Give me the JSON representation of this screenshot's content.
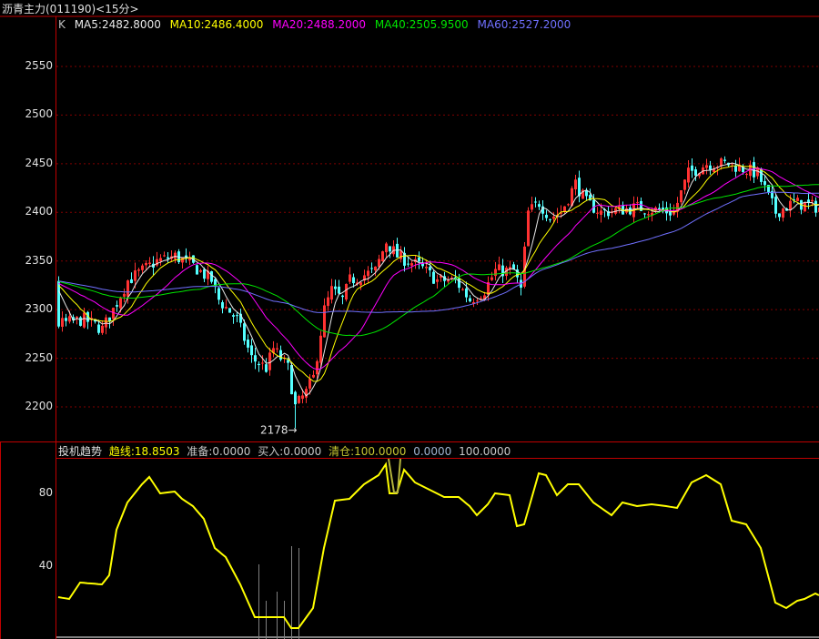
{
  "header": {
    "title": "沥青主力(011190)<15分>"
  },
  "legend": {
    "k": "K",
    "ma5": "MA5:2482.8000",
    "ma10": "MA10:2486.4000",
    "ma20": "MA20:2488.2000",
    "ma40": "MA40:2505.9500",
    "ma60": "MA60:2527.2000"
  },
  "indicator": {
    "name": "投机趋势",
    "trend": "趋线:18.8503",
    "prepare": "准备:0.0000",
    "buy": "买入:0.0000",
    "clear": "清仓:100.0000",
    "v1": "0.0000",
    "v2": "100.0000"
  },
  "colors": {
    "up": "#ff3232",
    "down": "#54ffff",
    "ma5": "#e8e8e8",
    "ma10": "#ffff00",
    "ma20": "#ff00ff",
    "ma40": "#00e600",
    "ma60": "#7070ff",
    "osc": "#ffff00",
    "axis": "#c00000",
    "grid": "#800000"
  },
  "chart_data": [
    {
      "type": "candlestick",
      "title": "沥青主力(011190)<15分>",
      "candle_count": 210,
      "ylim": [
        2170,
        2590
      ],
      "yticks": [
        "2550",
        "2500",
        "2450",
        "2400",
        "2350",
        "2300",
        "2250",
        "2200"
      ],
      "ytick_values": [
        2550,
        2500,
        2450,
        2400,
        2350,
        2300,
        2250,
        2200
      ],
      "close_keypoints": [
        [
          0,
          2285
        ],
        [
          7,
          2290
        ],
        [
          12,
          2280
        ],
        [
          15,
          2300
        ],
        [
          19,
          2330
        ],
        [
          27,
          2350
        ],
        [
          32,
          2355
        ],
        [
          37,
          2345
        ],
        [
          42,
          2330
        ],
        [
          44,
          2310
        ],
        [
          49,
          2290
        ],
        [
          53,
          2250
        ],
        [
          57,
          2240
        ],
        [
          59,
          2260
        ],
        [
          63,
          2240
        ],
        [
          65,
          2200
        ],
        [
          68,
          2215
        ],
        [
          70,
          2230
        ],
        [
          73,
          2300
        ],
        [
          75,
          2320
        ],
        [
          78,
          2310
        ],
        [
          80,
          2330
        ],
        [
          87,
          2340
        ],
        [
          90,
          2370
        ],
        [
          93,
          2355
        ],
        [
          99,
          2345
        ],
        [
          104,
          2330
        ],
        [
          109,
          2330
        ],
        [
          113,
          2310
        ],
        [
          117,
          2320
        ],
        [
          120,
          2340
        ],
        [
          125,
          2340
        ],
        [
          127,
          2320
        ],
        [
          129,
          2400
        ],
        [
          132,
          2410
        ],
        [
          135,
          2395
        ],
        [
          138,
          2400
        ],
        [
          142,
          2430
        ],
        [
          145,
          2410
        ],
        [
          149,
          2400
        ],
        [
          159,
          2405
        ],
        [
          169,
          2400
        ],
        [
          173,
          2440
        ],
        [
          178,
          2450
        ],
        [
          184,
          2450
        ],
        [
          192,
          2440
        ],
        [
          197,
          2400
        ],
        [
          202,
          2410
        ],
        [
          209,
          2405
        ]
      ],
      "prior_level": 2330,
      "low_marker": {
        "label": "2178",
        "index": 65,
        "value": 2178
      },
      "moving_averages": [
        5,
        10,
        20,
        40,
        60
      ]
    },
    {
      "type": "line",
      "title": "投机趋势",
      "ylim": [
        0,
        100
      ],
      "yticks": [
        "80",
        "40"
      ],
      "ytick_values": [
        80,
        40
      ],
      "series": [
        {
          "name": "趋线",
          "keypoints": [
            [
              0,
              23
            ],
            [
              3,
              22
            ],
            [
              6,
              31
            ],
            [
              12,
              30
            ],
            [
              14,
              35
            ],
            [
              16,
              60
            ],
            [
              19,
              75
            ],
            [
              23,
              85
            ],
            [
              25,
              89
            ],
            [
              28,
              80
            ],
            [
              32,
              81
            ],
            [
              34,
              77
            ],
            [
              37,
              73
            ],
            [
              40,
              66
            ],
            [
              43,
              50
            ],
            [
              46,
              45
            ],
            [
              50,
              30
            ],
            [
              54,
              12
            ],
            [
              58,
              12
            ],
            [
              62,
              12
            ],
            [
              64,
              6
            ],
            [
              66,
              6
            ],
            [
              70,
              17
            ],
            [
              73,
              50
            ],
            [
              76,
              76
            ],
            [
              80,
              77
            ],
            [
              84,
              85
            ],
            [
              88,
              90
            ],
            [
              90,
              96
            ],
            [
              91,
              80
            ],
            [
              93,
              80
            ],
            [
              95,
              93
            ],
            [
              98,
              86
            ],
            [
              102,
              82
            ],
            [
              106,
              78
            ],
            [
              110,
              78
            ],
            [
              113,
              73
            ],
            [
              115,
              68
            ],
            [
              118,
              74
            ],
            [
              120,
              80
            ],
            [
              124,
              79
            ],
            [
              126,
              62
            ],
            [
              128,
              63
            ],
            [
              132,
              91
            ],
            [
              134,
              90
            ],
            [
              137,
              79
            ],
            [
              140,
              85
            ],
            [
              143,
              85
            ],
            [
              147,
              75
            ],
            [
              152,
              68
            ],
            [
              155,
              75
            ],
            [
              159,
              73
            ],
            [
              163,
              74
            ],
            [
              167,
              73
            ],
            [
              170,
              72
            ],
            [
              174,
              86
            ],
            [
              178,
              90
            ],
            [
              182,
              85
            ],
            [
              185,
              65
            ],
            [
              189,
              63
            ],
            [
              193,
              50
            ],
            [
              197,
              20
            ],
            [
              200,
              17
            ],
            [
              203,
              21
            ],
            [
              205,
              22
            ],
            [
              208,
              25
            ],
            [
              209,
              24
            ]
          ]
        }
      ]
    }
  ]
}
